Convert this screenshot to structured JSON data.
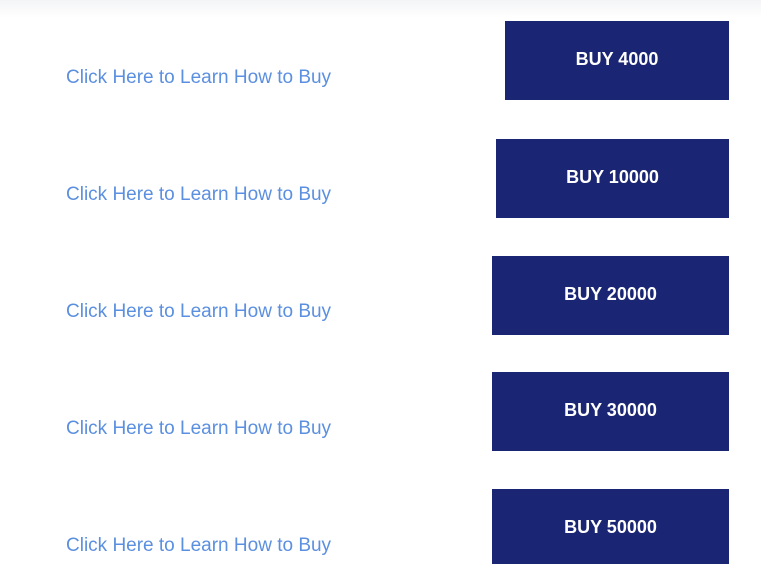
{
  "rows": [
    {
      "link_label": "Click Here to Learn How to Buy",
      "button_label": "BUY 4000"
    },
    {
      "link_label": "Click Here to Learn How to Buy",
      "button_label": "BUY 10000"
    },
    {
      "link_label": "Click Here to Learn How to Buy",
      "button_label": "BUY 20000"
    },
    {
      "link_label": "Click Here to Learn How to Buy",
      "button_label": "BUY 30000"
    },
    {
      "link_label": "Click Here to Learn How to Buy",
      "button_label": "BUY 50000"
    }
  ],
  "colors": {
    "link": "#5b8fe0",
    "button_bg": "#1a2673",
    "button_text": "#ffffff"
  }
}
